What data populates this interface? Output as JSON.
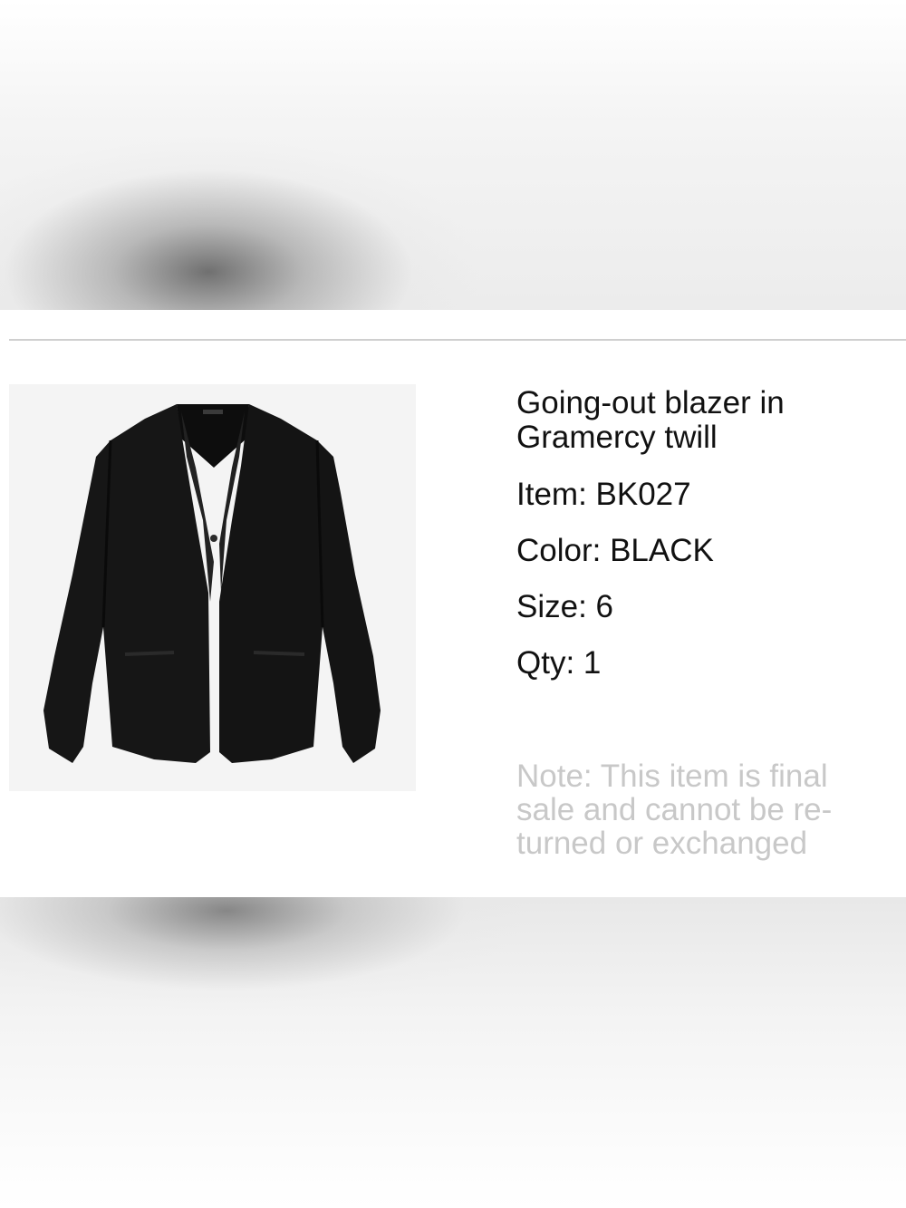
{
  "product": {
    "name": "Going-out blazer in Gramercy twill",
    "item_label": "Item: BK027",
    "color_label": "Color: BLACK",
    "size_label": "Size: 6",
    "qty_label": "Qty: 1",
    "image_icon": "black-blazer-photo"
  },
  "note": "Note: This item is final sale and cannot be re-turned or exchanged",
  "colors": {
    "text": "#111111",
    "note": "#c8c8c8",
    "divider": "#cfcfcf",
    "image_bg": "#f4f4f4",
    "garment": "#141414"
  }
}
